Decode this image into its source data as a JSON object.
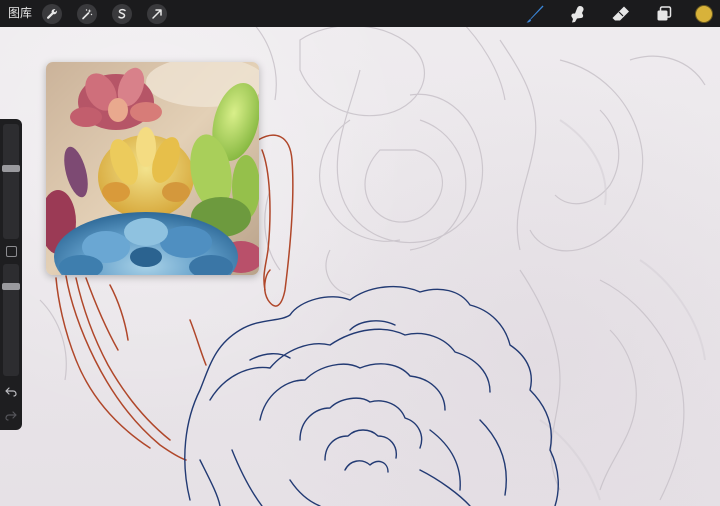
{
  "topbar": {
    "gallery_label": "图库",
    "left_tools": [
      {
        "name": "wrench-icon"
      },
      {
        "name": "magic-wand-icon"
      },
      {
        "name": "selection-icon"
      },
      {
        "name": "transform-arrow-icon"
      }
    ],
    "right_tools": [
      {
        "name": "brush-icon"
      },
      {
        "name": "smudge-icon"
      },
      {
        "name": "eraser-icon"
      },
      {
        "name": "layers-icon"
      }
    ],
    "active_color": "#d8b23a",
    "brush_color": "#3a86d8"
  },
  "sidebar": {
    "brush_size_level": 0.5,
    "opacity_level": 0.2,
    "modify_icon": "square-icon",
    "undo_icon": "undo-arrow-icon",
    "redo_icon": "redo-arrow-icon"
  },
  "reference": {
    "image": "succulent-photo"
  },
  "canvas": {
    "ink_color_navy": "#223a73",
    "ink_color_rust": "#b0472a",
    "sketch_color": "#c9c4cb"
  }
}
